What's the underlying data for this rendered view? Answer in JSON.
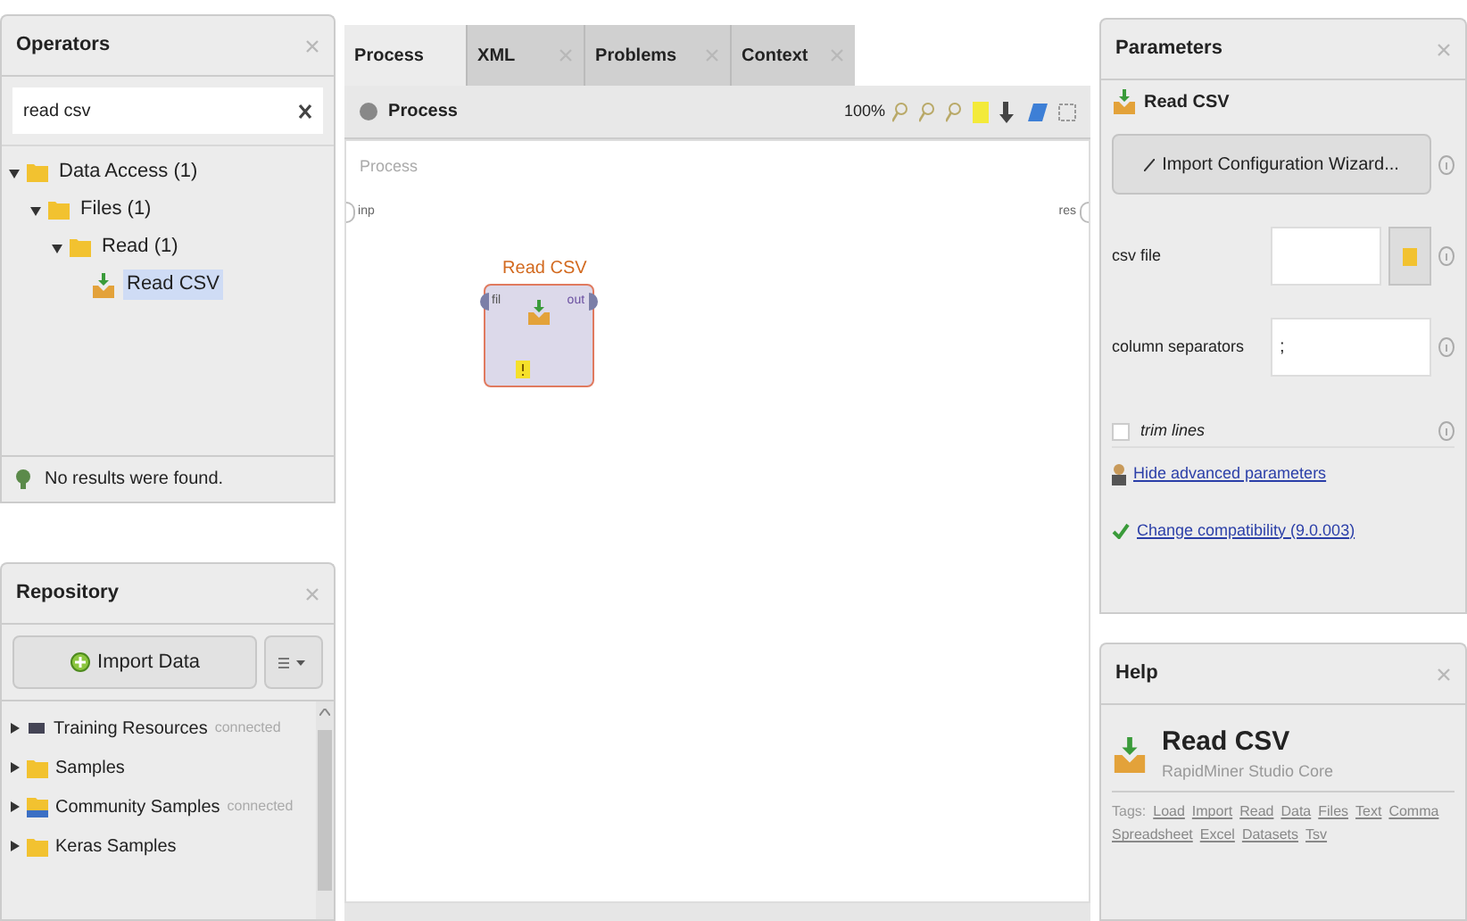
{
  "operators": {
    "tab": "Operators",
    "search": {
      "value": "read csv"
    },
    "tree": [
      {
        "label": "Data Access (1)",
        "kind": "folder",
        "expanded": true,
        "selected": false,
        "children": [
          {
            "label": "Files (1)",
            "kind": "folder",
            "expanded": true,
            "selected": false,
            "children": [
              {
                "label": "Read (1)",
                "kind": "folder",
                "expanded": true,
                "selected": false,
                "children": [
                  {
                    "label": "Read CSV",
                    "kind": "operator",
                    "selected": true
                  }
                ]
              }
            ]
          }
        ]
      }
    ],
    "status": "No results were found."
  },
  "repository": {
    "tab": "Repository",
    "import_button": "Import Data",
    "items": [
      {
        "label": "Training Resources",
        "status": "connected",
        "kind": "training"
      },
      {
        "label": "Samples",
        "kind": "folder"
      },
      {
        "label": "Community Samples",
        "status": "connected",
        "kind": "community"
      },
      {
        "label": "Keras Samples",
        "kind": "folder"
      }
    ]
  },
  "process": {
    "tabs": [
      {
        "label": "Process",
        "selected": true,
        "closable": false
      },
      {
        "label": "XML",
        "selected": false,
        "closable": true
      },
      {
        "label": "Problems",
        "selected": false,
        "closable": true
      },
      {
        "label": "Context",
        "selected": false,
        "closable": true
      }
    ],
    "breadcrumb": "Process",
    "zoom": "100%",
    "canvas_label": "Process",
    "input_port": "inp",
    "output_port": "res",
    "operator": {
      "name": "Read CSV",
      "in_port": "fil",
      "out_port": "out",
      "warning": true
    }
  },
  "parameters": {
    "tab": "Parameters",
    "operator": "Read CSV",
    "wizard_button": "Import Configuration Wizard...",
    "fields": [
      {
        "label": "csv file",
        "kind": "file"
      },
      {
        "label": "column separators",
        "kind": "text",
        "value": ";"
      },
      {
        "label": "trim lines",
        "kind": "checkbox",
        "checked": false
      }
    ],
    "links": [
      {
        "label": "Hide advanced parameters",
        "kind": "advanced"
      },
      {
        "label": "Change compatibility (9.0.003)",
        "kind": "compat"
      }
    ]
  },
  "help": {
    "tab": "Help",
    "title": "Read CSV",
    "subtitle": "RapidMiner Studio Core",
    "tags_label": "Tags:",
    "tags": [
      "Load",
      "Import",
      "Read",
      "Data",
      "Files",
      "Text",
      "Comma",
      "Spreadsheet",
      "Excel",
      "Datasets",
      "Tsv"
    ]
  }
}
